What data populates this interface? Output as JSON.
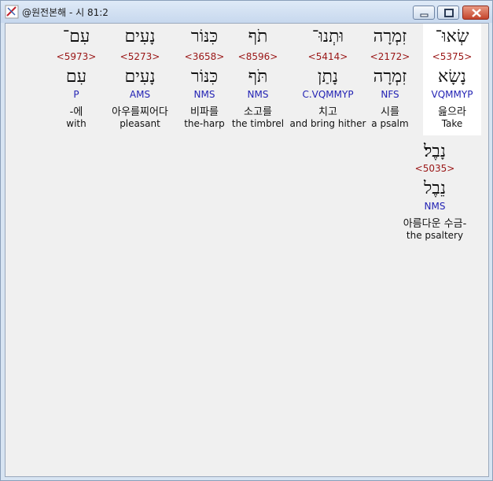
{
  "window": {
    "title": "@원전본해 - 시 81:2",
    "buttons": {
      "minimize": "minimize",
      "maximize": "maximize",
      "close": "close"
    }
  },
  "words": [
    {
      "heb": "שְׂאוּ־",
      "strong": "<5375>",
      "heb2": "נָשָׂא",
      "morph": "VQMMYP",
      "kor": "읊으라",
      "eng": "Take",
      "selected": true
    },
    {
      "heb": "זִמְרָה",
      "strong": "<2172>",
      "heb2": "זִמְרָה",
      "morph": "NFS",
      "kor": "시를",
      "eng": "a psalm"
    },
    {
      "heb": "וּתְנוּ־",
      "strong": "<5414>",
      "heb2": "נָתַן",
      "morph": "C.VQMMYP",
      "kor": "치고",
      "eng": "and bring hither"
    },
    {
      "heb": "תֹף",
      "strong": "<8596>",
      "heb2": "תֹּף",
      "morph": "NMS",
      "kor": "소고를",
      "eng": "the timbrel"
    },
    {
      "heb": "כִּנּוֹר",
      "strong": "<3658>",
      "heb2": "כִּנּוֹר",
      "morph": "NMS",
      "kor": "비파를",
      "eng": "the-harp"
    },
    {
      "heb": "נָעִים",
      "strong": "<5273>",
      "heb2": "נָעִים",
      "morph": "AMS",
      "kor": "아우를찌어다",
      "eng": "pleasant"
    },
    {
      "heb": "עִם־",
      "strong": "<5973>",
      "heb2": "עִם",
      "morph": "P",
      "kor": "-에",
      "eng": "with"
    },
    {
      "heb": "נָבֶל׃",
      "strong": "<5035>",
      "heb2": "נֵבֶל",
      "morph": "NMS",
      "kor": "아름다운 수금-",
      "eng": "the psaltery"
    }
  ]
}
